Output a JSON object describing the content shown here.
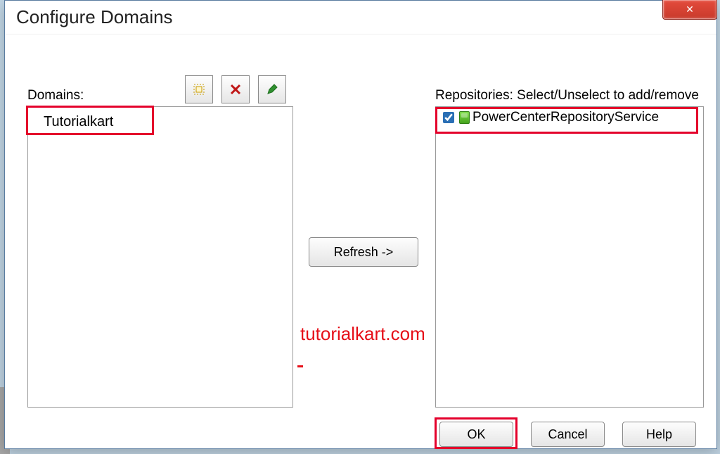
{
  "dialog": {
    "title": "Configure Domains",
    "close_glyph": "✕"
  },
  "labels": {
    "domains": "Domains:",
    "repositories": "Repositories: Select/Unselect to add/remove"
  },
  "toolbar": {
    "new_icon": "new-domain-icon",
    "delete_icon": "delete-domain-icon",
    "edit_icon": "edit-domain-icon"
  },
  "domains": {
    "items": [
      {
        "name": "Tutorialkart"
      }
    ]
  },
  "repositories": {
    "items": [
      {
        "name": "PowerCenterRepositoryService",
        "checked": true
      }
    ]
  },
  "buttons": {
    "refresh": "Refresh ->",
    "ok": "OK",
    "cancel": "Cancel",
    "help": "Help"
  },
  "watermark": "tutorialkart.com"
}
